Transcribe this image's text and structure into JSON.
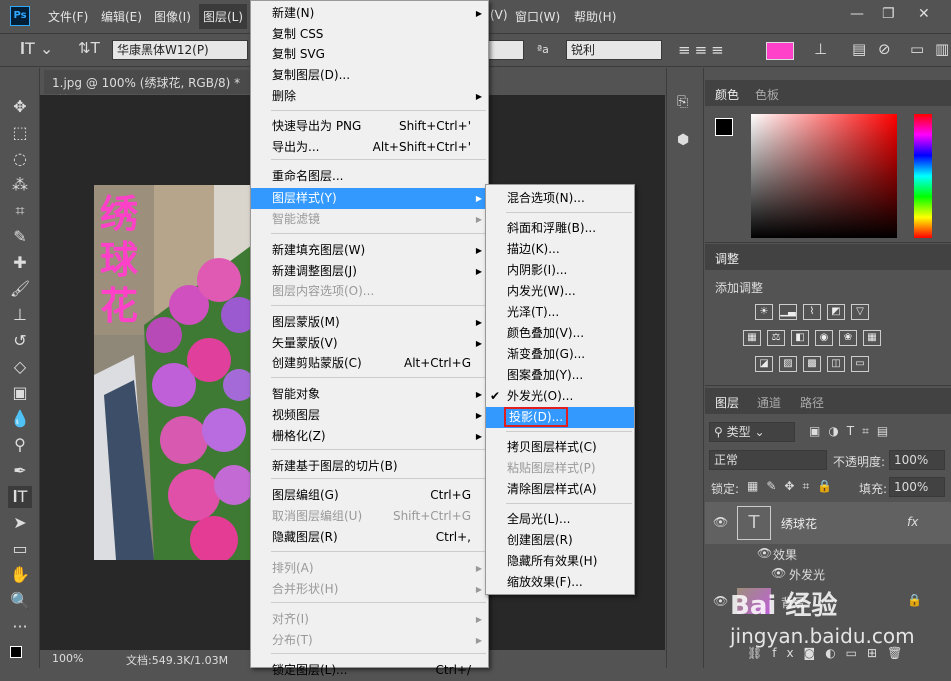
{
  "menubar": {
    "items": [
      "文件(F)",
      "编辑(E)",
      "图像(I)",
      "图层(L)",
      "(V)",
      "窗口(W)",
      "帮助(H)"
    ],
    "logo": "Ps"
  },
  "options": {
    "font_family": "华康黑体W12(P)",
    "aa_label": "ªa",
    "aa_mode": "锐利",
    "color": "#ff40c8"
  },
  "document": {
    "tab_title": "1.jpg @ 100% (绣球花, RGB/8) *",
    "close": "×",
    "overlay_text": [
      "绣",
      "球",
      "花"
    ]
  },
  "status": {
    "zoom": "100%",
    "doc_info": "文档:549.3K/1.03M"
  },
  "layer_menu": {
    "items": [
      {
        "label": "新建(N)",
        "arrow": true
      },
      {
        "label": "复制 CSS"
      },
      {
        "label": "复制 SVG"
      },
      {
        "label": "复制图层(D)..."
      },
      {
        "label": "删除",
        "arrow": true
      },
      {
        "label": "快速导出为 PNG",
        "shortcut": "Shift+Ctrl+'"
      },
      {
        "label": "导出为...",
        "shortcut": "Alt+Shift+Ctrl+'"
      },
      {
        "label": "重命名图层..."
      },
      {
        "label": "图层样式(Y)",
        "arrow": true,
        "highlight": true
      },
      {
        "label": "智能滤镜",
        "arrow": true,
        "disabled": true
      },
      {
        "label": "新建填充图层(W)",
        "arrow": true
      },
      {
        "label": "新建调整图层(J)",
        "arrow": true
      },
      {
        "label": "图层内容选项(O)...",
        "disabled": true
      },
      {
        "label": "图层蒙版(M)",
        "arrow": true
      },
      {
        "label": "矢量蒙版(V)",
        "arrow": true
      },
      {
        "label": "创建剪贴蒙版(C)",
        "shortcut": "Alt+Ctrl+G"
      },
      {
        "label": "智能对象",
        "arrow": true
      },
      {
        "label": "视频图层",
        "arrow": true
      },
      {
        "label": "栅格化(Z)",
        "arrow": true
      },
      {
        "label": "新建基于图层的切片(B)"
      },
      {
        "label": "图层编组(G)",
        "shortcut": "Ctrl+G"
      },
      {
        "label": "取消图层编组(U)",
        "shortcut": "Shift+Ctrl+G",
        "disabled": true
      },
      {
        "label": "隐藏图层(R)",
        "shortcut": "Ctrl+,"
      },
      {
        "label": "排列(A)",
        "arrow": true,
        "disabled": true
      },
      {
        "label": "合并形状(H)",
        "arrow": true,
        "disabled": true
      },
      {
        "label": "对齐(I)",
        "arrow": true,
        "disabled": true
      },
      {
        "label": "分布(T)",
        "arrow": true,
        "disabled": true
      },
      {
        "label": "锁定图层(L)...",
        "shortcut": "Ctrl+/"
      }
    ]
  },
  "style_menu": {
    "items": [
      {
        "label": "混合选项(N)..."
      },
      {
        "label": "斜面和浮雕(B)..."
      },
      {
        "label": "描边(K)..."
      },
      {
        "label": "内阴影(I)..."
      },
      {
        "label": "内发光(W)..."
      },
      {
        "label": "光泽(T)..."
      },
      {
        "label": "颜色叠加(V)..."
      },
      {
        "label": "渐变叠加(G)..."
      },
      {
        "label": "图案叠加(Y)..."
      },
      {
        "label": "外发光(O)...",
        "checked": true
      },
      {
        "label": "投影(D)...",
        "highlight": true
      },
      {
        "label": "拷贝图层样式(C)"
      },
      {
        "label": "粘贴图层样式(P)",
        "disabled": true
      },
      {
        "label": "清除图层样式(A)"
      },
      {
        "label": "全局光(L)..."
      },
      {
        "label": "创建图层(R)"
      },
      {
        "label": "隐藏所有效果(H)"
      },
      {
        "label": "缩放效果(F)..."
      }
    ]
  },
  "color_panel": {
    "tabs": [
      "颜色",
      "色板"
    ]
  },
  "adjust_panel": {
    "tab": "调整",
    "title": "添加调整"
  },
  "layers_panel": {
    "tabs": [
      "图层",
      "通道",
      "路径"
    ],
    "filter": "类型",
    "blend_mode": "正常",
    "opacity_label": "不透明度:",
    "opacity": "100%",
    "lock_label": "锁定:",
    "fill_label": "填充:",
    "fill": "100%",
    "layers": [
      {
        "name": "绣球花",
        "type": "text"
      },
      {
        "name": "效果"
      },
      {
        "name": "外发光"
      },
      {
        "name": "背景"
      }
    ]
  },
  "watermark": {
    "text": "Bai 经验",
    "url": "jingyan.baidu.com"
  }
}
